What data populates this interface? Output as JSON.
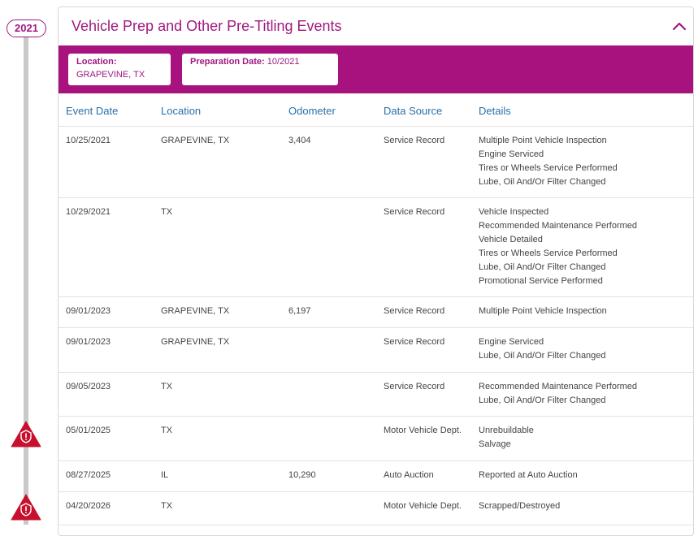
{
  "timeline": {
    "year": "2021"
  },
  "section": {
    "title": "Vehicle Prep and Other Pre-Titling Events",
    "collapse_icon": "chevron-up-icon",
    "location_label": "Location:",
    "location_value": "GRAPEVINE, TX",
    "prep_label": "Preparation Date:",
    "prep_value": "10/2021"
  },
  "columns": [
    "Event Date",
    "Location",
    "Odometer",
    "Data Source",
    "Details"
  ],
  "rows": [
    {
      "date": "10/25/2021",
      "location": "GRAPEVINE, TX",
      "odometer": "3,404",
      "source": "Service Record",
      "details": [
        "Multiple Point Vehicle Inspection",
        "Engine Serviced",
        "Tires or Wheels Service Performed",
        "Lube, Oil And/Or Filter Changed"
      ]
    },
    {
      "date": "10/29/2021",
      "location": "TX",
      "odometer": "",
      "source": "Service Record",
      "details": [
        "Vehicle Inspected",
        "Recommended Maintenance Performed",
        "Vehicle Detailed",
        "Tires or Wheels Service Performed",
        "Lube, Oil And/Or Filter Changed",
        "Promotional Service Performed"
      ]
    },
    {
      "date": "09/01/2023",
      "location": "GRAPEVINE, TX",
      "odometer": "6,197",
      "source": "Service Record",
      "details": [
        "Multiple Point Vehicle Inspection"
      ]
    },
    {
      "date": "09/01/2023",
      "location": "GRAPEVINE, TX",
      "odometer": "",
      "source": "Service Record",
      "details": [
        "Engine Serviced",
        "Lube, Oil And/Or Filter Changed"
      ]
    },
    {
      "date": "09/05/2023",
      "location": "TX",
      "odometer": "",
      "source": "Service Record",
      "details": [
        "Recommended Maintenance Performed",
        "Lube, Oil And/Or Filter Changed"
      ]
    },
    {
      "date": "05/01/2025",
      "location": "TX",
      "odometer": "",
      "source": "Motor Vehicle Dept.",
      "details": [
        "Unrebuildable",
        "Salvage"
      ]
    },
    {
      "date": "08/27/2025",
      "location": "IL",
      "odometer": "10,290",
      "source": "Auto Auction",
      "details": [
        "Reported at Auto Auction"
      ]
    },
    {
      "date": "04/20/2026",
      "location": "TX",
      "odometer": "",
      "source": "Motor Vehicle Dept.",
      "details": [
        "Scrapped/Destroyed"
      ]
    }
  ],
  "colors": {
    "accent": "#a0197f",
    "band": "#a8127e",
    "header_text": "#2a6fa8",
    "alert": "#c8102e"
  }
}
